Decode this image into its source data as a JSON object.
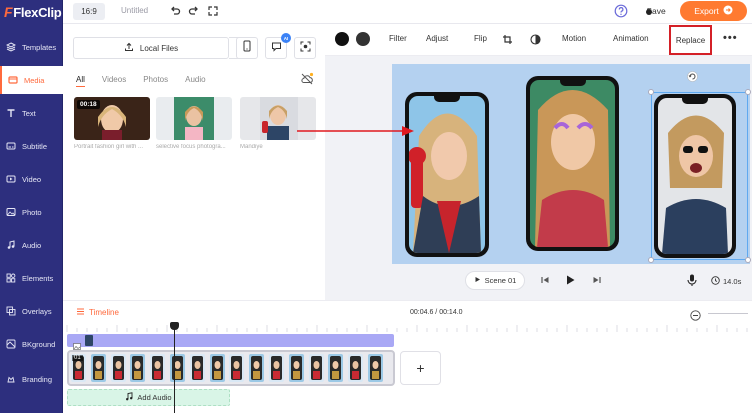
{
  "app": {
    "logo_text": "FlexClip",
    "logo_mark": "F",
    "ratio": "16:9",
    "doc_title": "Untitled"
  },
  "header": {
    "save_label": "Save",
    "export_label": "Export"
  },
  "sidebar": {
    "items": [
      {
        "label": "Templates",
        "icon": "templates-icon"
      },
      {
        "label": "Media",
        "icon": "media-icon",
        "active": true
      },
      {
        "label": "Text",
        "icon": "text-icon"
      },
      {
        "label": "Subtitle",
        "icon": "subtitle-icon"
      },
      {
        "label": "Video",
        "icon": "video-icon"
      },
      {
        "label": "Photo",
        "icon": "photo-icon"
      },
      {
        "label": "Audio",
        "icon": "audio-icon"
      },
      {
        "label": "Elements",
        "icon": "elements-icon"
      },
      {
        "label": "Overlays",
        "icon": "overlays-icon"
      },
      {
        "label": "BKground",
        "icon": "background-icon"
      },
      {
        "label": "Branding",
        "icon": "branding-icon"
      }
    ]
  },
  "media": {
    "local_files_label": "Local Files",
    "ai_badge": "AI",
    "tabs": [
      {
        "label": "All",
        "active": true
      },
      {
        "label": "Videos"
      },
      {
        "label": "Photos"
      },
      {
        "label": "Audio"
      }
    ],
    "items": [
      {
        "caption": "Portrait fashion girl with ...",
        "duration": "00:18"
      },
      {
        "caption": "selective focus photogra..."
      },
      {
        "caption": "Mandiye"
      }
    ]
  },
  "toolbar": {
    "filter": "Filter",
    "adjust": "Adjust",
    "flip": "Flip",
    "motion": "Motion",
    "animation": "Animation",
    "replace": "Replace",
    "colors": [
      "#111111",
      "#333333"
    ]
  },
  "playback": {
    "scene_label": "Scene 01",
    "duration": "14.0s"
  },
  "timeline": {
    "label": "Timeline",
    "time": "00:04.6 / 00:14.0",
    "scene_number": "01",
    "add_audio_label": "Add Audio",
    "add_scene_symbol": "+"
  },
  "colors": {
    "sidebar": "#2d2f7e",
    "accent": "#ff6a3d",
    "export": "#ff7a30",
    "highlight": "#d42027",
    "canvas_bg": "#b4d1f0",
    "overlay_track": "#a9a8f5",
    "audio_track": "#d9f5e7"
  }
}
